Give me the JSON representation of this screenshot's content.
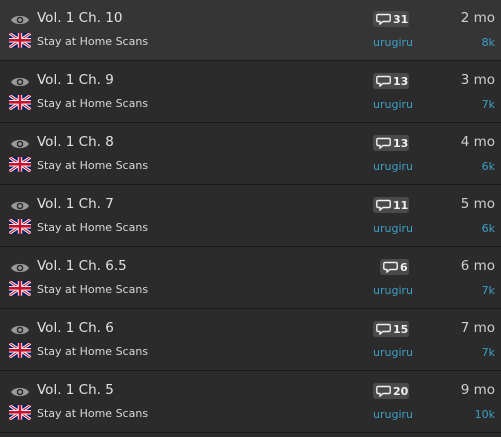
{
  "colors": {
    "background": "#2b2b2b",
    "highlight_row": "#353535",
    "link": "#3d9fc4",
    "badge": "#4a4a4a"
  },
  "icons": {
    "read_status": "eye-icon",
    "language": "uk-flag-icon",
    "comments": "comment-bubble-icon"
  },
  "chapters": [
    {
      "title": "Vol. 1 Ch. 10",
      "group": "Stay at Home Scans",
      "comments": "31",
      "uploader": "urugiru",
      "time": "2 mo",
      "views": "8k"
    },
    {
      "title": "Vol. 1 Ch. 9",
      "group": "Stay at Home Scans",
      "comments": "13",
      "uploader": "urugiru",
      "time": "3 mo",
      "views": "7k"
    },
    {
      "title": "Vol. 1 Ch. 8",
      "group": "Stay at Home Scans",
      "comments": "13",
      "uploader": "urugiru",
      "time": "4 mo",
      "views": "6k"
    },
    {
      "title": "Vol. 1 Ch. 7",
      "group": "Stay at Home Scans",
      "comments": "11",
      "uploader": "urugiru",
      "time": "5 mo",
      "views": "6k"
    },
    {
      "title": "Vol. 1 Ch. 6.5",
      "group": "Stay at Home Scans",
      "comments": "6",
      "uploader": "urugiru",
      "time": "6 mo",
      "views": "7k"
    },
    {
      "title": "Vol. 1 Ch. 6",
      "group": "Stay at Home Scans",
      "comments": "15",
      "uploader": "urugiru",
      "time": "7 mo",
      "views": "7k"
    },
    {
      "title": "Vol. 1 Ch. 5",
      "group": "Stay at Home Scans",
      "comments": "20",
      "uploader": "urugiru",
      "time": "9 mo",
      "views": "10k"
    }
  ]
}
